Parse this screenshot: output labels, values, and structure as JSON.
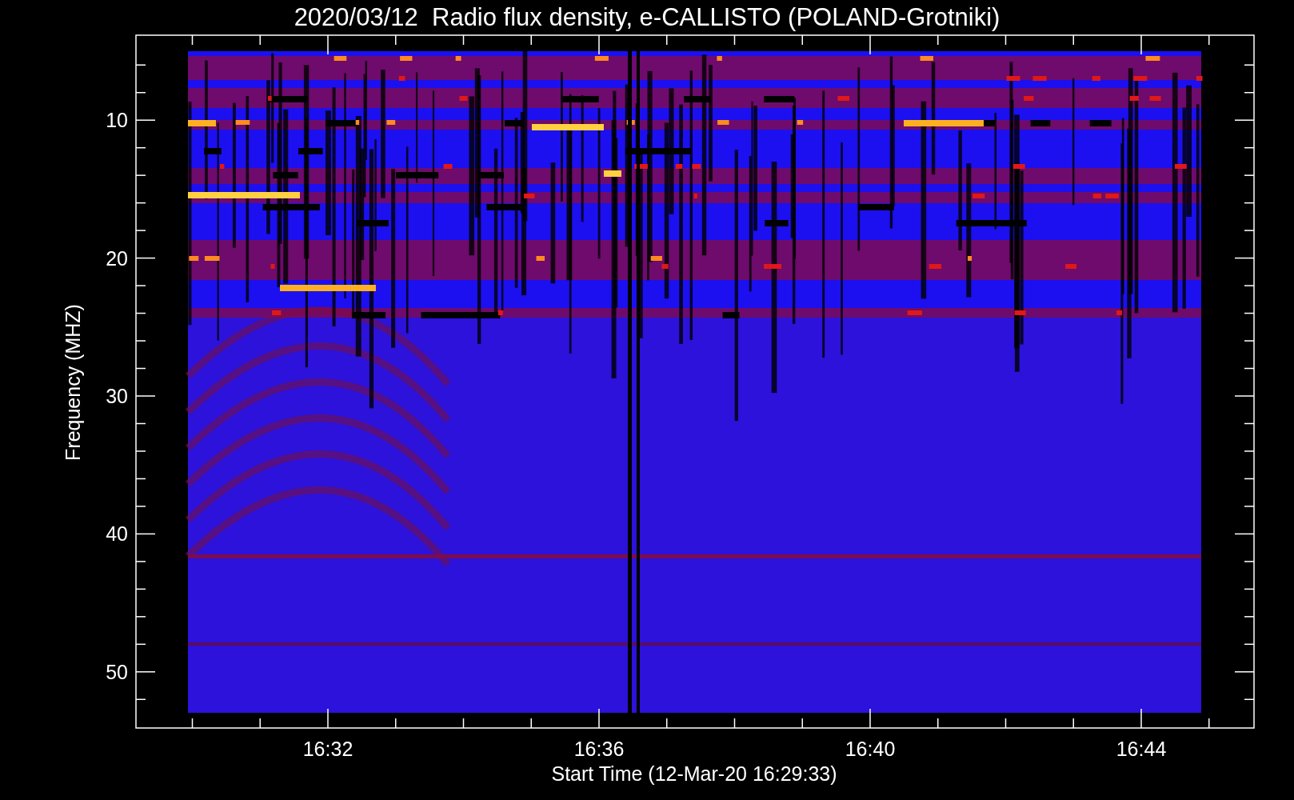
{
  "title": "2020/03/12  Radio flux density, e-CALLISTO (POLAND-Grotniki)",
  "y_axis": {
    "label": "Frequency (MHZ)",
    "ticks": [
      "10",
      "20",
      "30",
      "40",
      "50"
    ]
  },
  "x_axis": {
    "label": "Start Time (12-Mar-20 16:29:33)",
    "ticks": [
      "16:32",
      "16:36",
      "16:40",
      "16:44"
    ]
  }
}
